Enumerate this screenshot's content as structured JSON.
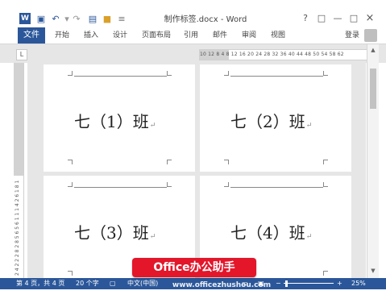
{
  "titlebar": {
    "app_icon": "W",
    "title": "制作标签.docx - Word",
    "icons": [
      "save-icon",
      "undo-icon",
      "redo-icon",
      "new-doc-icon",
      "open-folder-icon",
      "customize-qat-icon"
    ],
    "help": "?",
    "restore": "□",
    "minimize": "—",
    "maximize": "□",
    "close": "×"
  },
  "ribbon": {
    "file": "文件",
    "tabs": [
      "开始",
      "插入",
      "设计",
      "页面布局",
      "引用",
      "邮件",
      "审阅",
      "视图"
    ],
    "login": "登录"
  },
  "ruler": {
    "corner": "L",
    "horizontal": [
      "10",
      "12",
      "8",
      "4",
      "8",
      "12",
      "16",
      "20",
      "24",
      "28",
      "32",
      "36",
      "40",
      "44",
      "48",
      "50",
      "54",
      "58",
      "62"
    ],
    "vertical": "2 4 2 2 2 8 2 8 5 6 5 6 1 1 1 4 2 6 1 8 1 2 8 4"
  },
  "labels": [
    {
      "text": "七（1）班"
    },
    {
      "text": "七（2）班"
    },
    {
      "text": "七（3）班"
    },
    {
      "text": "七（4）班"
    }
  ],
  "paragraph_mark": "↵",
  "statusbar": {
    "page": "第 4 页，共 4 页",
    "words": "20 个字",
    "language": "中文(中国)",
    "zoom": "25%",
    "zoom_level": 25
  },
  "overlay": {
    "badge": "Office办公助手",
    "watermark": "www.officezhushou.com"
  },
  "colors": {
    "accent": "#2b579a",
    "badge": "#e3162a"
  }
}
